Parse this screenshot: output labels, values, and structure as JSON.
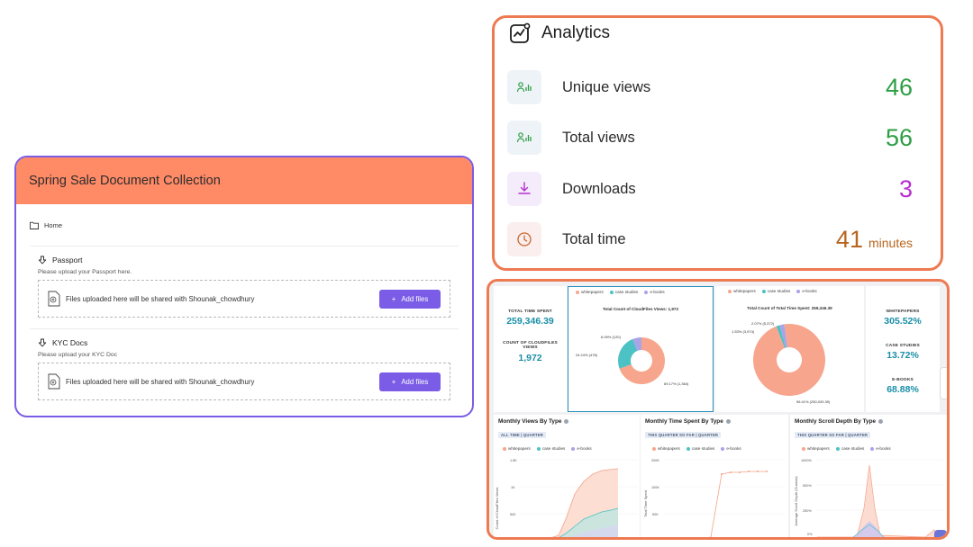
{
  "doc_collection": {
    "title": "Spring Sale Document Collection",
    "breadcrumb": "Home",
    "sections": [
      {
        "title": "Passport",
        "description": "Please upload your Passport here.",
        "dropzone_text": "Files uploaded here will be shared with Shounak_chowdhury",
        "button_label": "Add files"
      },
      {
        "title": "KYC Docs",
        "description": "Please upload your KYC Doc",
        "dropzone_text": "Files uploaded here will be shared with Shounak_chowdhury",
        "button_label": "Add files"
      }
    ],
    "colors": {
      "header": "#ff8a66",
      "accent": "#7b5ce6"
    }
  },
  "analytics": {
    "title": "Analytics",
    "rows": [
      {
        "label": "Unique views",
        "value": "46",
        "unit": "",
        "icon": "users-chart-icon",
        "color": "#2e9e44"
      },
      {
        "label": "Total views",
        "value": "56",
        "unit": "",
        "icon": "users-chart-icon",
        "color": "#2e9e44"
      },
      {
        "label": "Downloads",
        "value": "3",
        "unit": "",
        "icon": "download-icon",
        "color": "#b62fd0"
      },
      {
        "label": "Total time",
        "value": "41",
        "unit": "minutes",
        "icon": "clock-icon",
        "color": "#b8651f"
      }
    ]
  },
  "dashboard": {
    "kpis": {
      "total_time_label": "TOTAL TIME SPENT",
      "total_time_value": "259,346.39",
      "count_label_1": "COUNT OF CLOUDFILES",
      "count_label_2": "VIEWS",
      "count_value": "1,972"
    },
    "legend": [
      "whitepapers",
      "case studies",
      "e-books"
    ],
    "legend_colors": [
      "#f7a58c",
      "#4cc2c4",
      "#a9a3e8"
    ],
    "donut1": {
      "title": "Total Count of CloudFiles Views:",
      "title_value": "1,972",
      "labels": [
        "6.09% (120)",
        "24.24% (478)",
        "69.17% (1,364)"
      ]
    },
    "donut2": {
      "title": "Total Count of Total Time Spent:",
      "title_value": "259,346.39",
      "labels": [
        "2.07% (5,372)",
        "1.53% (3,974)",
        "96.41% (250,039.39)"
      ]
    },
    "percents": [
      {
        "label": "WHITEPAPERS",
        "value": "305.52%"
      },
      {
        "label": "CASE STUDIES",
        "value": "13.72%"
      },
      {
        "label": "E-BOOKS",
        "value": "68.88%"
      }
    ],
    "charts": [
      {
        "title": "Monthly Views By Type",
        "badge": "ALL TIME | QUARTER",
        "ylabel": "Count of CloudFiles Views",
        "ticks": [
          "1.5K",
          "1K",
          "500"
        ]
      },
      {
        "title": "Monthly Time Spent By Type",
        "badge": "THIS QUARTER SO FAR | QUARTER",
        "ylabel": "Total Time Spent",
        "ticks": [
          "200K",
          "100K",
          "50K"
        ]
      },
      {
        "title": "Monthly Scroll Depth By Type",
        "badge": "THIS QUARTER SO FAR | QUARTER",
        "ylabel": "Average Scroll Depth (Custom)",
        "ticks": [
          "1000%",
          "500%",
          "250%",
          "0%"
        ]
      }
    ]
  },
  "chart_data": [
    {
      "type": "pie",
      "title": "Total Count of CloudFiles Views: 1,972",
      "categories": [
        "whitepapers",
        "case studies",
        "e-books"
      ],
      "values": [
        1364,
        478,
        120
      ]
    },
    {
      "type": "pie",
      "title": "Total Count of Total Time Spent: 259,346.39",
      "categories": [
        "whitepapers",
        "case studies",
        "e-books"
      ],
      "values": [
        250039.39,
        3974,
        5372
      ]
    }
  ]
}
